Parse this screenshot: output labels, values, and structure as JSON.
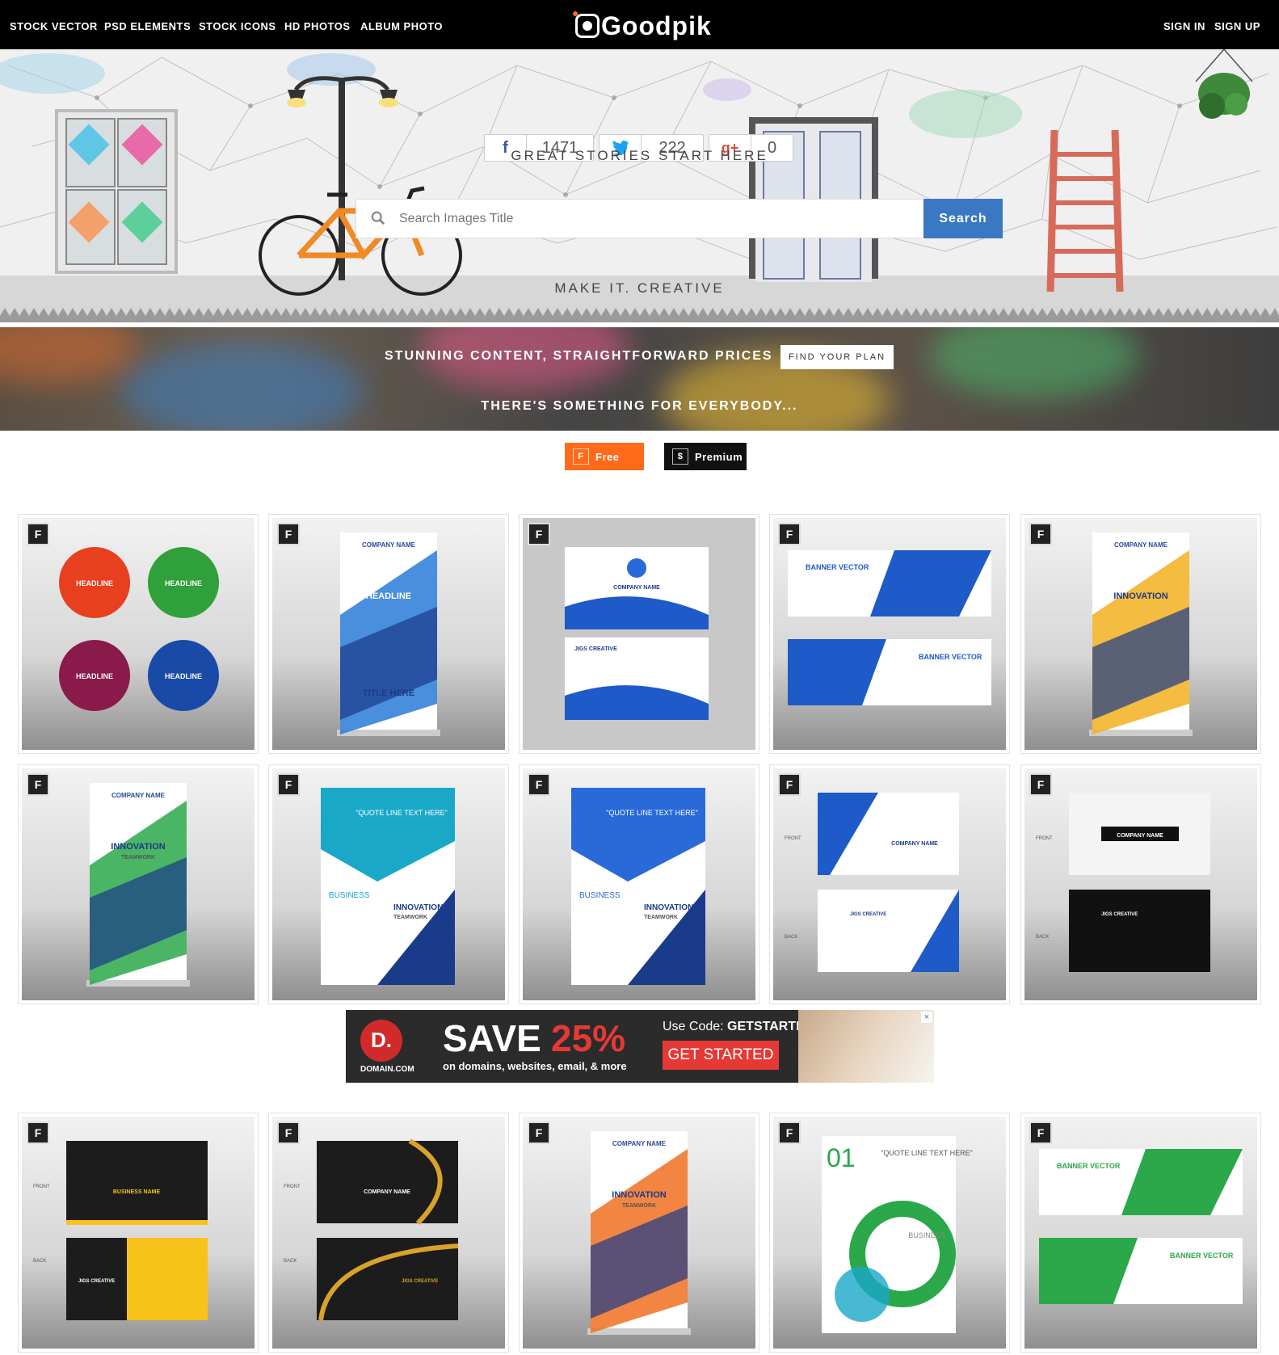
{
  "nav": {
    "links": [
      "STOCK VECTOR",
      "PSD ELEMENTS",
      "STOCK ICONS",
      "HD PHOTOS",
      "ALBUM PHOTO"
    ],
    "brand": "Goodpik",
    "sign_in": "SIGN IN",
    "sign_up": "SIGN UP"
  },
  "social": {
    "facebook_icon": "f",
    "facebook_count": "1471",
    "twitter_icon": "twitter-bird",
    "twitter_count": "222",
    "googleplus_icon": "g+",
    "googleplus_count": "0"
  },
  "hero": {
    "tagline": "GREAT STORIES START HERE",
    "search_placeholder": "Search Images Title",
    "search_button": "Search",
    "subline": "MAKE IT. CREATIVE"
  },
  "promo": {
    "headline": "STUNNING CONTENT, STRAIGHTFORWARD PRICES",
    "cta": "FIND YOUR PLAN",
    "subline": "THERE'S SOMETHING FOR EVERYBODY..."
  },
  "filters": {
    "free_badge": "F",
    "free_label": "Free",
    "premium_badge": "$",
    "premium_label": "Premium",
    "free_color": "#ff6b1a",
    "premium_color": "#111111"
  },
  "badge": "F",
  "cards": [
    {
      "kind": "circles",
      "labels": [
        "HEADLINE",
        "HEADLINE",
        "HEADLINE",
        "HEADLINE"
      ]
    },
    {
      "kind": "rollup",
      "title": "COMPANY NAME",
      "headline": "HEADLINE",
      "footer": "TITLE HERE"
    },
    {
      "kind": "bizcard",
      "title": "COMPANY NAME",
      "sub": "JIGS CREATIVE"
    },
    {
      "kind": "banner",
      "title": "BANNER VECTOR"
    },
    {
      "kind": "rollup2",
      "title": "COMPANY NAME",
      "headline": "INNOVATION"
    },
    {
      "kind": "rollup3",
      "title": "COMPANY NAME",
      "headline": "INNOVATION",
      "sub": "TEAMWORK"
    },
    {
      "kind": "flyer",
      "quote": "\"QUOTE LINE TEXT HERE\"",
      "headline": "INNOVATION",
      "sub": "TEAMWORK",
      "biz": "BUSINESS"
    },
    {
      "kind": "flyer2",
      "quote": "\"QUOTE LINE TEXT HERE\"",
      "headline": "INNOVATION",
      "sub": "TEAMWORK",
      "biz": "BUSINESS"
    },
    {
      "kind": "bizcard2",
      "title": "COMPANY NAME",
      "front": "FRONT",
      "back": "BACK",
      "sub": "JIGS CREATIVE"
    },
    {
      "kind": "bizcard3",
      "title": "COMPANY NAME",
      "front": "FRONT",
      "back": "BACK",
      "sub": "JIGS CREATIVE"
    },
    {
      "kind": "goldcard",
      "title": "BUSINESS NAME",
      "front": "FRONT",
      "back": "BACK",
      "sub": "JIGS CREATIVE"
    },
    {
      "kind": "goldcard2",
      "title": "COMPANY NAME",
      "front": "FRONT",
      "back": "BACK",
      "sub": "JIGS CREATIVE"
    },
    {
      "kind": "rollup4",
      "title": "COMPANY NAME",
      "headline": "INNOVATION",
      "sub": "TEAMWORK"
    },
    {
      "kind": "greenflyer",
      "num": "01",
      "quote": "\"QUOTE LINE TEXT HERE\"",
      "biz": "BUSINESS"
    },
    {
      "kind": "greenbanner",
      "title": "BANNER VECTOR"
    }
  ],
  "ad": {
    "brand": "DOMAIN.COM",
    "save": "SAVE",
    "percent": "25%",
    "sub": "on domains, websites, email, & more",
    "code_label": "Use Code:",
    "code": "GETSTARTED",
    "cta": "GET STARTED"
  }
}
